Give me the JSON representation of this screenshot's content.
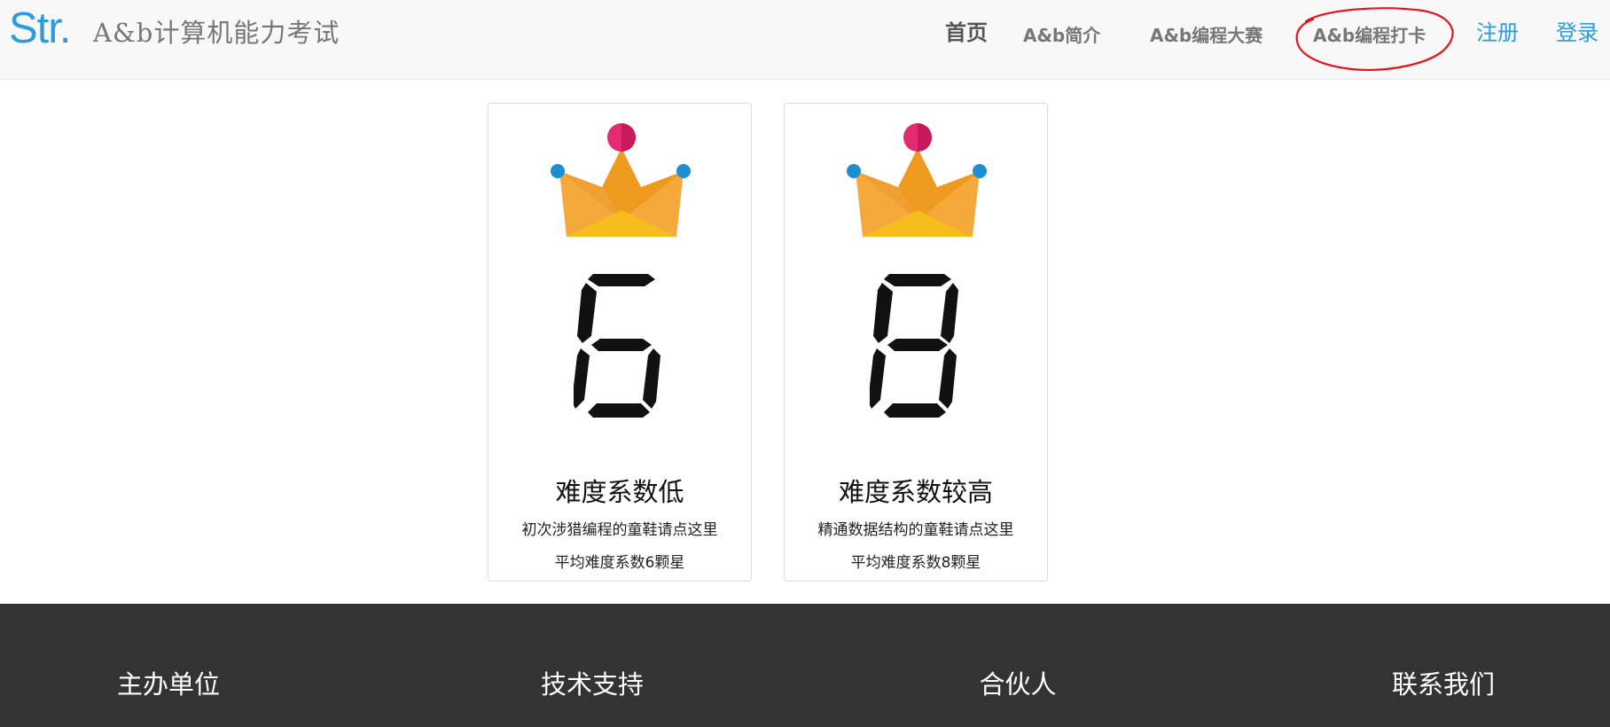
{
  "header": {
    "logo_mark": "Str.",
    "site_title": "A&b计算机能力考试",
    "nav": {
      "home": "首页",
      "intro": "A&b简介",
      "contest": "A&b编程大赛",
      "checkin": "A&b编程打卡",
      "register": "注册",
      "login": "登录"
    },
    "annotation": "red-circle-highlight"
  },
  "cards": [
    {
      "icon": "crown-icon",
      "digit": "6",
      "title": "难度系数低",
      "desc": "初次涉猎编程的童鞋请点这里",
      "avg": "平均难度系数6颗星"
    },
    {
      "icon": "crown-icon",
      "digit": "8",
      "title": "难度系数较高",
      "desc": "精通数据结构的童鞋请点这里",
      "avg": "平均难度系数8颗星"
    }
  ],
  "footer": {
    "headings": [
      "主办单位",
      "技术支持",
      "合伙人",
      "联系我们"
    ]
  },
  "colors": {
    "brand_blue": "#2c9be0",
    "header_bg": "#f8f8f8",
    "footer_bg": "#333333",
    "annotation_red": "#e8141c",
    "crown_orange": "#f4a93a",
    "crown_dark": "#ee9a1e",
    "crown_yellow": "#f6bd1d",
    "jewel_pink": "#e12a6f",
    "jewel_blue": "#1b8fd2"
  }
}
